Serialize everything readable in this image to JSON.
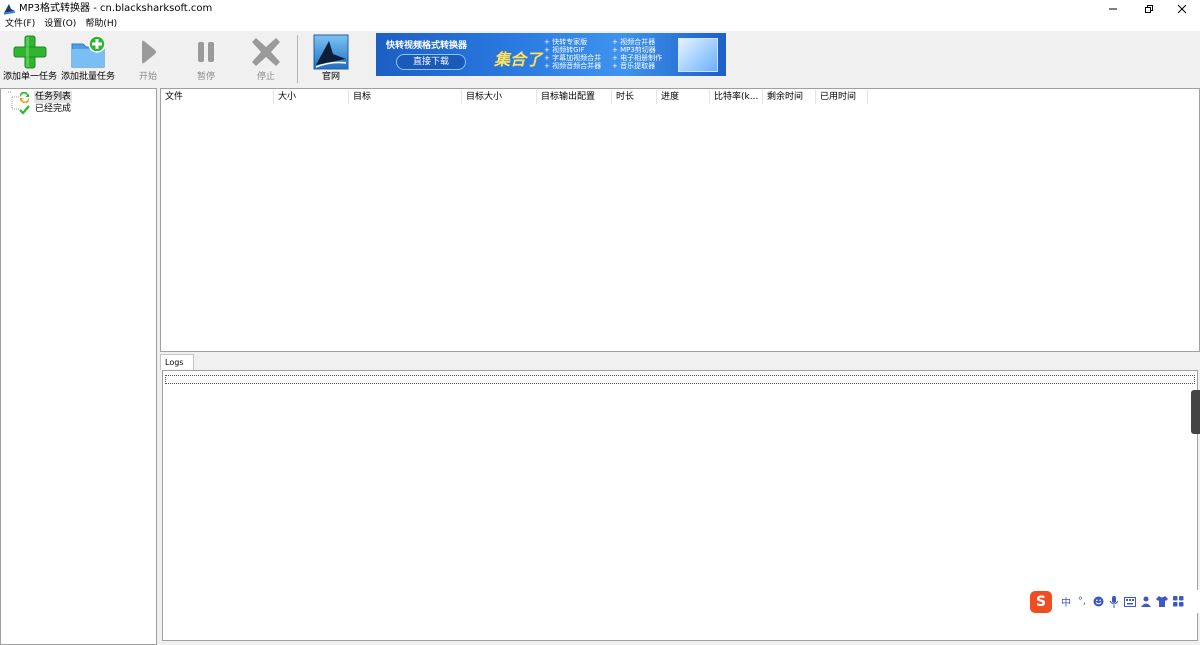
{
  "window": {
    "title": "MP3格式转换器 - cn.blacksharksoft.com"
  },
  "menu": [
    "文件(F)",
    "设置(O)",
    "帮助(H)"
  ],
  "toolbar": {
    "add_single": "添加单一任务",
    "add_batch": "添加批量任务",
    "start": "开始",
    "pause": "暂停",
    "stop": "停止",
    "website": "官网"
  },
  "banner": {
    "title": "快转视频格式转换器",
    "download": "直接下载",
    "headline": "集合了",
    "features_left": [
      "+ 快转专家版",
      "+ 视频转GIF",
      "+ 字幕加视频合并",
      "+ 视频音频合并器"
    ],
    "features_right": [
      "+ 视频合并器",
      "+ MP3剪切器",
      "+ 电子相册制作",
      "+ 音乐提取器"
    ]
  },
  "tree": {
    "items": [
      "任务列表",
      "已经完成"
    ]
  },
  "table": {
    "columns": [
      "文件",
      "大小",
      "目标",
      "目标大小",
      "目标输出配置",
      "时长",
      "进度",
      "比特率(k...",
      "剩余时间",
      "已用时间"
    ]
  },
  "logs": {
    "tab_label": "Logs"
  },
  "ime": {
    "mode": "中",
    "punct": "°,"
  },
  "colors": {
    "add_green": "#2fb52f",
    "folder_blue": "#4a9fe8",
    "disabled_gray": "#9a9a9a",
    "banner_blue": "#2a7ae0",
    "ime_red": "#ef4e23"
  }
}
